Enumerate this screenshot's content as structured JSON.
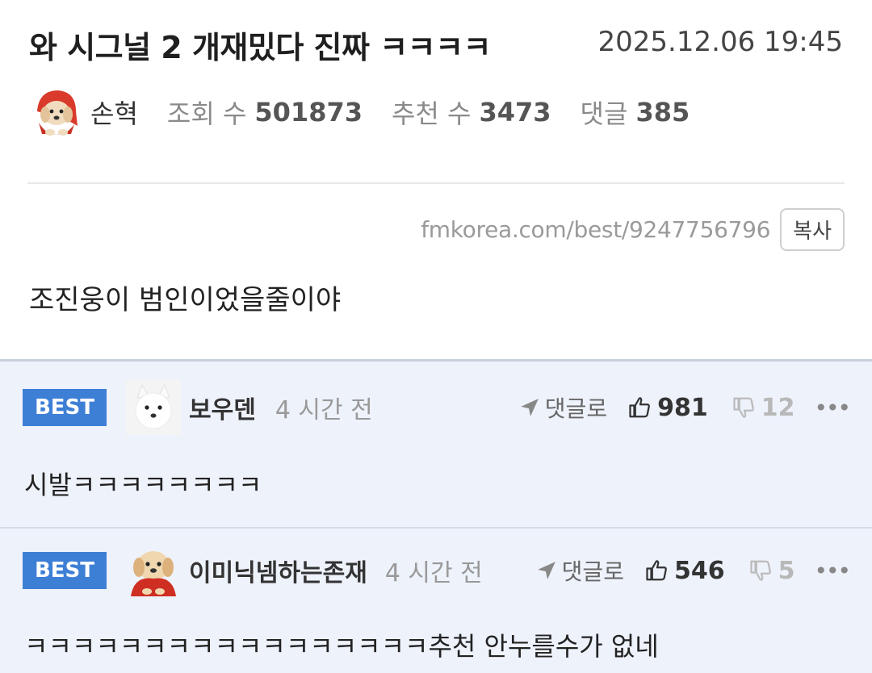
{
  "post": {
    "title": "와 시그널 2 개재밌다 진짜 ㅋㅋㅋㅋ",
    "date": "2025.12.06 19:45",
    "author": "손혁",
    "views_label": "조회 수",
    "views": "501873",
    "recommend_label": "추천 수",
    "recommend": "3473",
    "comments_label": "댓글",
    "comments": "385",
    "url": "fmkorea.com/best/9247756796",
    "copy_label": "복사",
    "body": "조진웅이 범인이었을줄이야"
  },
  "comments": [
    {
      "badge": "BEST",
      "name": "보우덴",
      "time": "4 시간 전",
      "reply_label": "댓글로",
      "likes": "981",
      "dislikes": "12",
      "more": "•••",
      "text": "시발ㅋㅋㅋㅋㅋㅋㅋㅋ"
    },
    {
      "badge": "BEST",
      "name": "이미닉넴하는존재",
      "time": "4 시간 전",
      "reply_label": "댓글로",
      "likes": "546",
      "dislikes": "5",
      "more": "•••",
      "text": "ㅋㅋㅋㅋㅋㅋㅋㅋㅋㅋㅋㅋㅋㅋㅋㅋㅋ추천 안누를수가 없네"
    }
  ],
  "colors": {
    "best_badge": "#3e7fd6",
    "comment_bg": "#eef2fb"
  },
  "icons": {
    "reply": "send-arrow-icon",
    "like": "thumbs-up-icon",
    "dislike": "thumbs-down-icon",
    "more": "more-dots-icon"
  }
}
